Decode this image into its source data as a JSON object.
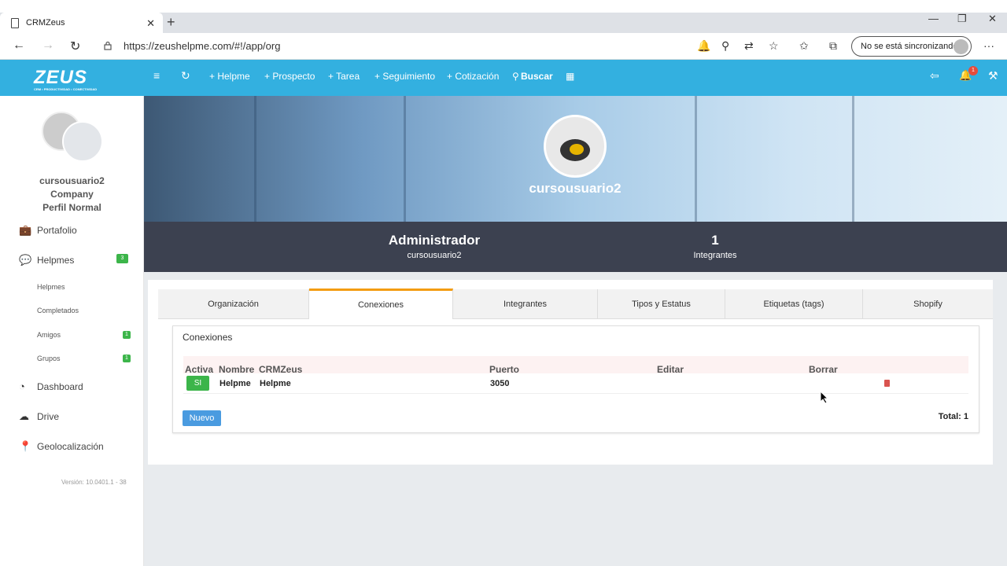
{
  "browser": {
    "tab_title": "CRMZeus",
    "url": "https://zeushelpme.com/#!/app/org",
    "sync_label": "No se está sincronizando"
  },
  "header": {
    "logo": "ZEUS",
    "logo_tagline": "CRM • PRODUCTIVIDAD • CONECTIVIDAD",
    "links": [
      "+ Helpme",
      "+ Prospecto",
      "+ Tarea",
      "+ Seguimiento",
      "+ Cotización"
    ],
    "search": "Buscar",
    "notif_count": "1"
  },
  "sidebar": {
    "user": "cursousuario2",
    "company": "Company",
    "profile": "Perfil Normal",
    "items": {
      "portafolio": "Portafolio",
      "helpmes": "Helpmes",
      "helpmes_badge": "3",
      "sub_helpmes": "Helpmes",
      "sub_completados": "Completados",
      "sub_amigos": "Amigos",
      "amigos_badge": "1",
      "sub_grupos": "Grupos",
      "grupos_badge": "1",
      "dashboard": "Dashboard",
      "drive": "Drive",
      "geo": "Geolocalización"
    },
    "version": "Versión: 10.0401.1 - 38"
  },
  "profile": {
    "name": "cursousuario2",
    "role": "Administrador",
    "role_user": "cursousuario2",
    "members_count": "1",
    "members_label": "Integrantes"
  },
  "tabs": [
    "Organización",
    "Conexiones",
    "Integrantes",
    "Tipos y Estatus",
    "Etiquetas (tags)",
    "Shopify"
  ],
  "conexiones": {
    "title": "Conexiones",
    "columns": [
      "Activa",
      "Nombre",
      "CRMZeus",
      "Puerto",
      "Editar",
      "Borrar"
    ],
    "rows": [
      {
        "activa": "SI",
        "nombre": "Helpme",
        "crmzeus": "Helpme",
        "puerto": "3050"
      }
    ],
    "new_button": "Nuevo",
    "total": "Total: 1"
  }
}
